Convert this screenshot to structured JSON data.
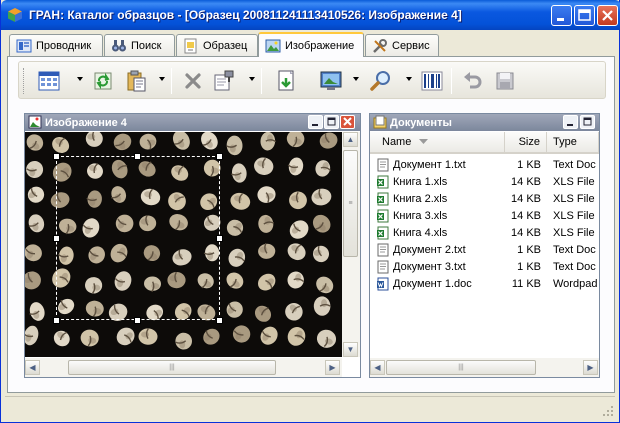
{
  "window": {
    "title": "ГРАН: Каталог образцов - [Образец 200811241113410526: Изображение 4]",
    "app_icon": "cube-icon",
    "controls": [
      "minimize",
      "maximize",
      "close"
    ]
  },
  "tabs": [
    {
      "label": "Проводник",
      "icon": "explorer-icon",
      "active": false
    },
    {
      "label": "Поиск",
      "icon": "binoculars-icon",
      "active": false
    },
    {
      "label": "Образец",
      "icon": "sample-icon",
      "active": false
    },
    {
      "label": "Изображение",
      "icon": "image-icon",
      "active": true
    },
    {
      "label": "Сервис",
      "icon": "tools-icon",
      "active": false
    }
  ],
  "toolbar": {
    "buttons": [
      "grid-view-icon",
      "refresh-icon",
      "paste-icon",
      "delete-icon",
      "properties-icon",
      "import-icon",
      "screen-capture-icon",
      "zoom-icon",
      "barcode-icon",
      "undo-icon",
      "save-icon"
    ]
  },
  "image_pane": {
    "title": "Изображение 4",
    "icon": "image-file-icon"
  },
  "documents_pane": {
    "title": "Документы",
    "icon": "documents-icon",
    "columns": [
      "Name",
      "Size",
      "Type"
    ],
    "sort_column": "Name",
    "rows": [
      {
        "name": "Документ 1.txt",
        "size": "1 KB",
        "type": "Text Doc",
        "icon": "text-file-icon"
      },
      {
        "name": "Книга 1.xls",
        "size": "14 KB",
        "type": "XLS File",
        "icon": "excel-file-icon"
      },
      {
        "name": "Книга 2.xls",
        "size": "14 KB",
        "type": "XLS File",
        "icon": "excel-file-icon"
      },
      {
        "name": "Книга 3.xls",
        "size": "14 KB",
        "type": "XLS File",
        "icon": "excel-file-icon"
      },
      {
        "name": "Книга 4.xls",
        "size": "14 KB",
        "type": "XLS File",
        "icon": "excel-file-icon"
      },
      {
        "name": "Документ 2.txt",
        "size": "1 KB",
        "type": "Text Doc",
        "icon": "text-file-icon"
      },
      {
        "name": "Документ 3.txt",
        "size": "1 KB",
        "type": "Text Doc",
        "icon": "text-file-icon"
      },
      {
        "name": "Документ 1.doc",
        "size": "11 KB",
        "type": "Wordpad",
        "icon": "word-file-icon"
      }
    ]
  },
  "colors": {
    "titlebar": "#0a58e0",
    "pane_title": "#8a93a7",
    "active_tab_accent": "#ffc83c"
  }
}
